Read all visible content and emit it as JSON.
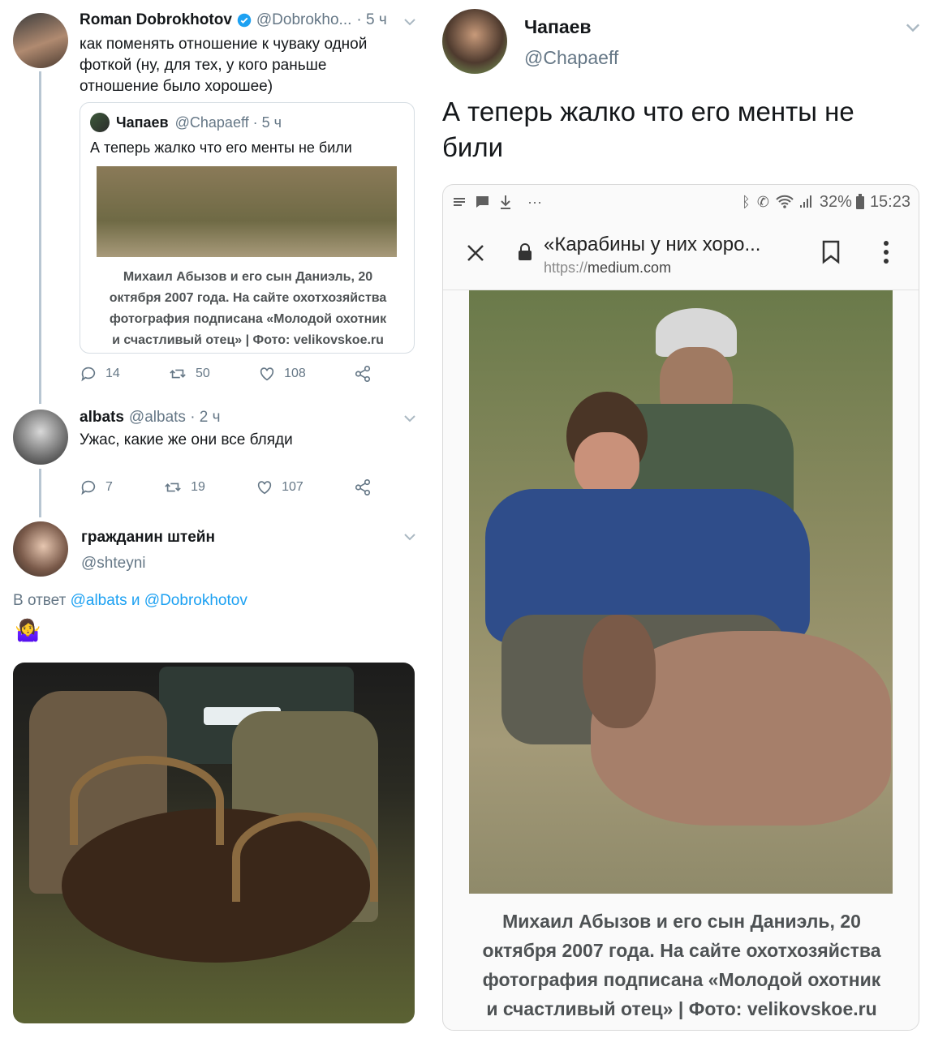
{
  "left_thread": {
    "tweet1": {
      "author": "Roman Dobrokhotov",
      "handle": "@Dobrokho...",
      "time": "· 5 ч",
      "text": "как поменять отношение к чуваку одной фоткой (ну, для тех, у кого раньше отношение было хорошее)",
      "quote": {
        "author": "Чапаев",
        "handle": "@Chapaeff · 5 ч",
        "text": "А теперь жалко что его менты не били",
        "caption_lines": [
          "Михаил Абызов и его сын Даниэль, 20",
          "октября 2007 года. На сайте охотхозяйства",
          "фотография подписана «Молодой охотник",
          "и счастливый отец» | Фото: velikovskoe.ru"
        ]
      },
      "replies": "14",
      "retweets": "50",
      "likes": "108"
    },
    "tweet2": {
      "author": "albats",
      "handle": "@albats · 2 ч",
      "text": "Ужас, какие же они все бляди",
      "replies": "7",
      "retweets": "19",
      "likes": "107"
    },
    "tweet3": {
      "author": "гражданин штейн",
      "handle": "@shteyni",
      "reply_prefix": "В ответ",
      "reply_user1": "@albats",
      "reply_and": "и",
      "reply_user2": "@Dobrokhotov",
      "emoji": "🤷‍♀️"
    }
  },
  "right_tweet": {
    "author": "Чапаев",
    "handle": "@Chapaeff",
    "text": "А теперь жалко что его менты не били",
    "phone": {
      "battery": "32%",
      "time": "15:23",
      "page_title": "«Карабины у них хоро...",
      "url_scheme": "https://",
      "url_host": "medium.com",
      "caption_lines": [
        "Михаил Абызов и его сын Даниэль, 20",
        "октября 2007 года. На сайте охотхозяйства",
        "фотография подписана «Молодой охотник",
        "и счастливый отец» | Фото: velikovskoe.ru"
      ]
    }
  },
  "colors": {
    "link": "#1da1f2",
    "muted": "#657786",
    "verified": "#1da1f2"
  }
}
